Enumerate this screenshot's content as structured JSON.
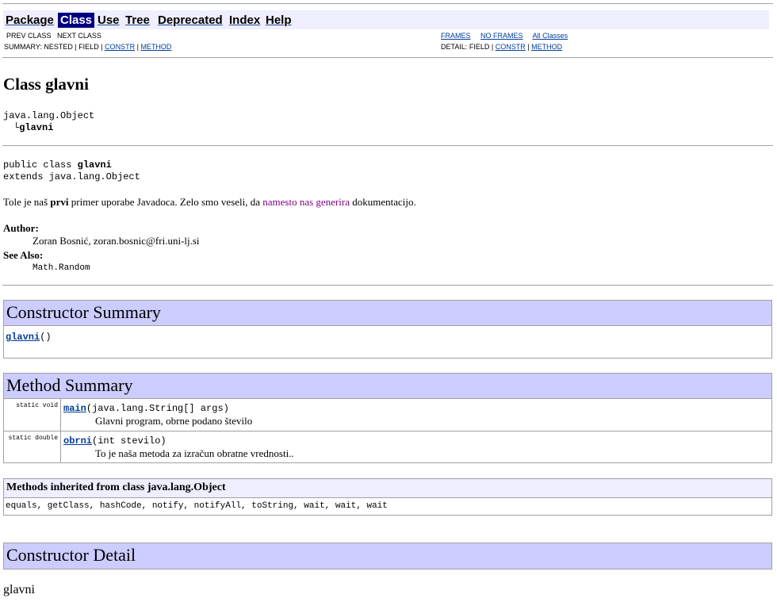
{
  "navbar": {
    "items": [
      "Package",
      "Class",
      "Use",
      "Tree",
      "Deprecated",
      "Index",
      "Help"
    ],
    "selected": "Class",
    "prev_class": "PREV CLASS",
    "next_class": "NEXT CLASS",
    "summary_prefix": "SUMMARY: NESTED | FIELD |",
    "summary_constr": "CONSTR",
    "summary_sep": "|",
    "summary_method": "METHOD",
    "frames": "FRAMES",
    "no_frames": "NO FRAMES",
    "all_classes": "All Classes",
    "detail_prefix": "DETAIL: FIELD |",
    "detail_constr": "CONSTR",
    "detail_sep": "|",
    "detail_method": "METHOD"
  },
  "class_title": "Class glavni",
  "hierarchy": {
    "parent": "java.lang.Object",
    "tree_glyph": "└",
    "child": "glavni"
  },
  "declaration": {
    "line1_prefix": "public class ",
    "line1_name": "glavni",
    "line2": "extends java.lang.Object"
  },
  "description": {
    "part1": "Tole je naš ",
    "bold": "prvi",
    "part2": " primer uporabe Javadoca. Zelo smo veseli, da ",
    "link": "namesto nas generira",
    "part3": " dokumentacijo."
  },
  "tags": {
    "author_label": "Author:",
    "author_value": "Zoran Bosnić, zoran.bosnic@fri.uni-lj.si",
    "see_also_label": "See Also:",
    "see_also_value": "Math.Random"
  },
  "constructor_summary": {
    "title": "Constructor Summary",
    "name": "glavni",
    "args": "()"
  },
  "method_summary": {
    "title": "Method Summary",
    "rows": [
      {
        "modifier": "static void",
        "name": "main",
        "sig": "(java.lang.String[] args)",
        "desc": "Glavni program, obrne podano število"
      },
      {
        "modifier": "static double",
        "name": "obrni",
        "sig": "(int stevilo)",
        "desc": "To je naša metoda za izračun obratne vrednosti.."
      }
    ]
  },
  "inherited": {
    "title": "Methods inherited from class java.lang.Object",
    "methods": "equals, getClass, hashCode, notify, notifyAll, toString, wait, wait, wait"
  },
  "constructor_detail": {
    "title": "Constructor Detail",
    "name": "glavni"
  }
}
